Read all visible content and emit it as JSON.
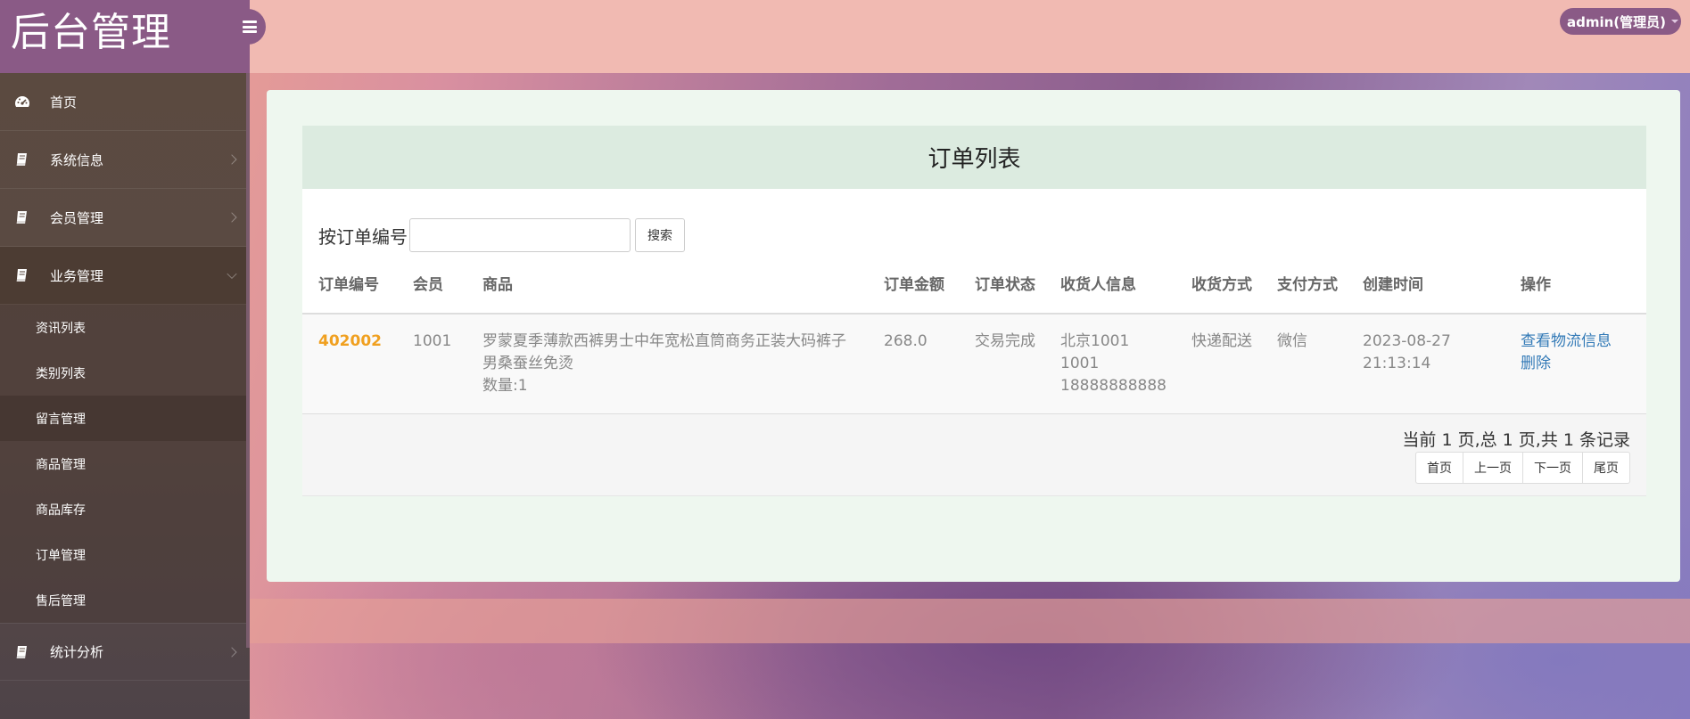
{
  "brand": "后台管理",
  "user_menu": {
    "label": "admin(管理员)"
  },
  "sidebar": {
    "items": [
      {
        "label": "首页",
        "icon": "dashboard-icon"
      },
      {
        "label": "系统信息",
        "icon": "book-icon"
      },
      {
        "label": "会员管理",
        "icon": "book-icon"
      },
      {
        "label": "业务管理",
        "icon": "book-icon",
        "expanded": true
      },
      {
        "label": "统计分析",
        "icon": "book-icon"
      }
    ],
    "sub_items": [
      "资讯列表",
      "类别列表",
      "留言管理",
      "商品管理",
      "商品库存",
      "订单管理",
      "售后管理"
    ]
  },
  "main": {
    "title": "订单列表",
    "search": {
      "label": "按订单编号",
      "value": "",
      "button": "搜索"
    },
    "table": {
      "headers": [
        "订单编号",
        "会员",
        "商品",
        "订单金额",
        "订单状态",
        "收货人信息",
        "收货方式",
        "支付方式",
        "创建时间",
        "操作"
      ],
      "rows": [
        {
          "order_id": "402002",
          "member": "1001",
          "product": "罗蒙夏季薄款西裤男士中年宽松直筒商务正装大码裤子男桑蚕丝免烫",
          "quantity": "数量:1",
          "amount": "268.0",
          "status": "交易完成",
          "receiver_city": "北京1001",
          "receiver_name": "1001",
          "receiver_phone": "18888888888",
          "delivery": "快递配送",
          "payment": "微信",
          "created_date": "2023-08-27",
          "created_time": "21:13:14",
          "op_view": "查看物流信息",
          "op_delete": "删除"
        }
      ]
    },
    "pagination": {
      "summary": "当前 1 页,总 1 页,共 1 条记录",
      "first": "首页",
      "prev": "上一页",
      "next": "下一页",
      "last": "尾页"
    }
  },
  "colors": {
    "accent_purple": "#8a5a86",
    "order_id": "#f0a020",
    "link": "#337ab7"
  }
}
